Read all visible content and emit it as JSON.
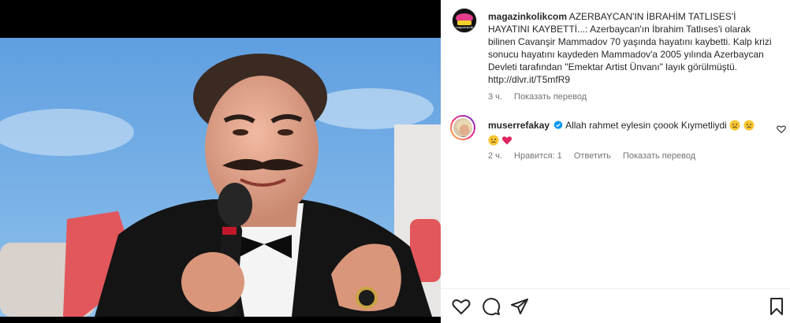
{
  "post": {
    "username": "magazinkolikcom",
    "caption_text": "AZERBAYCAN'IN İBRAHİM TATLISES'İ HAYATINI KAYBETTİ...: Azerbaycan'ın İbrahim Tatlıses'i olarak bilinen Cavanşir Mammadov 70 yaşında hayatını kaybetti. Kalp krizi sonucu hayatını kaydeden Mammadov'a 2005 yılında Azerbaycan Devleti tarafından \"Emektar Artist Ünvanı\" layık görülmüştü.",
    "caption_link": "http://dlvr.it/T5mfR9",
    "time_ago": "3 ч.",
    "translate_label": "Показать перевод",
    "avatar_text": "magazinkolik"
  },
  "comment": {
    "username": "muserrefakay",
    "text": "Allah rahmet eylesin çoook Kıymetliydi",
    "time_ago": "2 ч.",
    "likes_label": "Нравится: 1",
    "reply_label": "Ответить",
    "translate_label": "Показать перевод"
  },
  "icons": {
    "like": "heart-icon",
    "comment": "comment-icon",
    "share": "paper-plane-icon",
    "save": "bookmark-icon",
    "verified": "verified-badge-icon"
  },
  "colors": {
    "text": "#262626",
    "secondary": "#737373",
    "verified": "#0095f6",
    "heart_red": "#e0245e"
  }
}
